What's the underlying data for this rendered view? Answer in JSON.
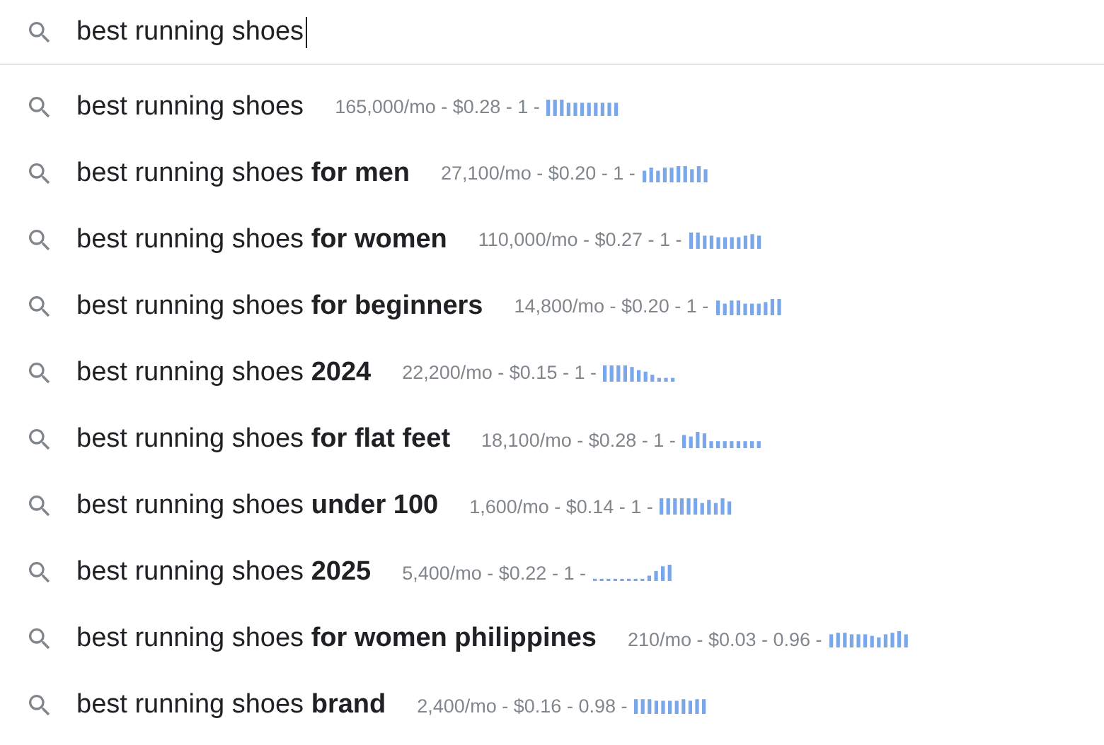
{
  "search": {
    "value": "best running shoes"
  },
  "suggestions": [
    {
      "text": "best running shoes",
      "metrics": "165,000/mo - $0.28 - 1 -"
    },
    {
      "text": "best running shoes **for men**",
      "metrics": "27,100/mo - $0.20 - 1 -"
    },
    {
      "text": "best running shoes **for women**",
      "metrics": "110,000/mo - $0.27 - 1 -"
    },
    {
      "text": "best running shoes **for beginners**",
      "metrics": "14,800/mo - $0.20 - 1 -"
    },
    {
      "text": "best running shoes **2024**",
      "metrics": "22,200/mo - $0.15 - 1 -"
    },
    {
      "text": "best running shoes **for flat feet**",
      "metrics": "18,100/mo - $0.28 - 1 -"
    },
    {
      "text": "best running shoes **under 100**",
      "metrics": "1,600/mo - $0.14 - 1 -"
    },
    {
      "text": "best running shoes **2025**",
      "metrics": "5,400/mo - $0.22 - 1 -"
    },
    {
      "text": "best running shoes **for women philippines**",
      "metrics": "210/mo - $0.03 - 0.96 -"
    },
    {
      "text": "best running shoes **brand**",
      "metrics": "2,400/mo - $0.16 - 0.98 -"
    }
  ]
}
